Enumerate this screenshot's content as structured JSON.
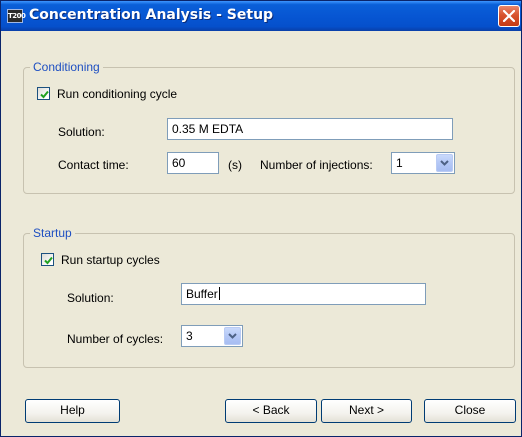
{
  "window": {
    "title": "Concentration Analysis - Setup",
    "icon_text": "T200"
  },
  "conditioning": {
    "legend": "Conditioning",
    "run_checkbox": {
      "label": "Run conditioning cycle",
      "checked": true
    },
    "solution_label": "Solution:",
    "solution_value": "0.35 M EDTA",
    "contact_time_label": "Contact time:",
    "contact_time_value": "60",
    "contact_time_unit": "(s)",
    "injections_label": "Number of injections:",
    "injections_value": "1"
  },
  "startup": {
    "legend": "Startup",
    "run_checkbox": {
      "label": "Run startup cycles",
      "checked": true
    },
    "solution_label": "Solution:",
    "solution_value": "Buffer",
    "cycles_label": "Number of cycles:",
    "cycles_value": "3"
  },
  "buttons": {
    "help": "Help",
    "back": "< Back",
    "next": "Next >",
    "close": "Close"
  },
  "colors": {
    "title_bar": "#0756d3",
    "legend_text": "#1e4fc2",
    "dialog_bg": "#ece9d8",
    "checkmark": "#21a121"
  }
}
